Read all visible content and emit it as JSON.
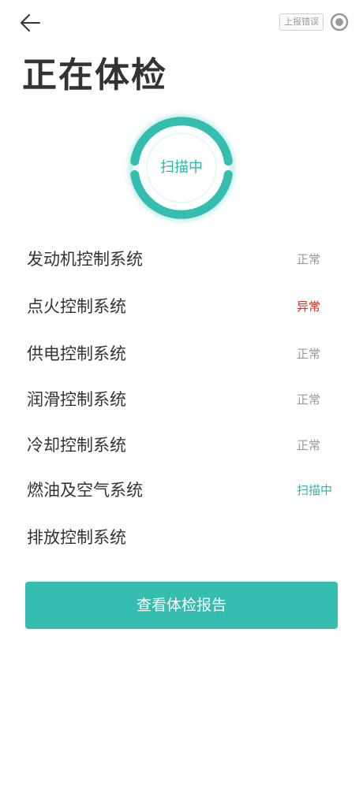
{
  "header": {
    "back_icon": "arrow-left-icon",
    "report_error_label": "上报错误",
    "record_icon": "record-icon"
  },
  "page": {
    "title": "正在体检"
  },
  "scan_indicator": {
    "label": "扫描中"
  },
  "colors": {
    "accent": "#35bdb0",
    "abnormal": "#d93025",
    "normal": "#999999"
  },
  "systems": [
    {
      "name": "发动机控制系统",
      "status": "正常",
      "status_type": "normal"
    },
    {
      "name": "点火控制系统",
      "status": "异常",
      "status_type": "abnormal"
    },
    {
      "name": "供电控制系统",
      "status": "正常",
      "status_type": "normal"
    },
    {
      "name": "润滑控制系统",
      "status": "正常",
      "status_type": "normal"
    },
    {
      "name": "冷却控制系统",
      "status": "正常",
      "status_type": "normal"
    },
    {
      "name": "燃油及空气系统",
      "status": "扫描中",
      "status_type": "scanning"
    },
    {
      "name": "排放控制系统",
      "status": "",
      "status_type": "pending"
    }
  ],
  "footer": {
    "view_report_label": "查看体检报告"
  }
}
